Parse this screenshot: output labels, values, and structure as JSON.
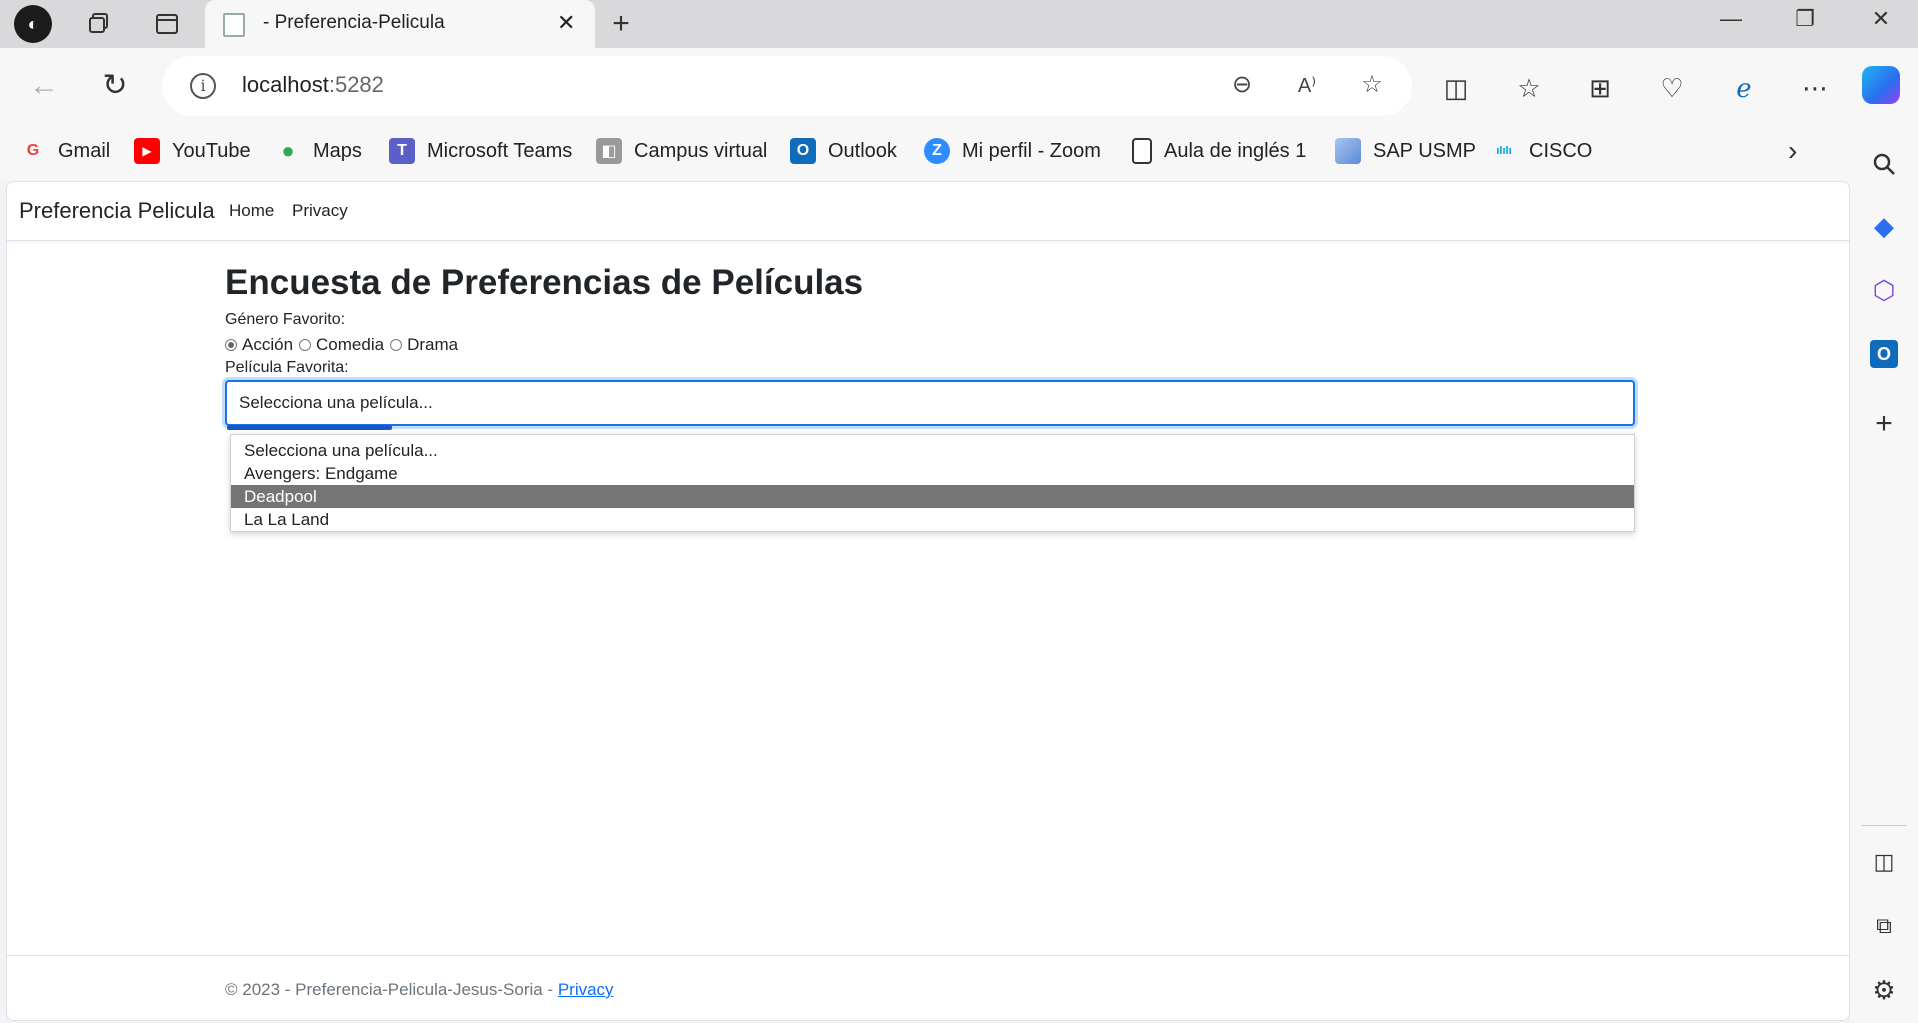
{
  "browser": {
    "tab_title": "- Preferencia-Pelicula",
    "url_host": "localhost",
    "url_port": ":5282"
  },
  "favorites": [
    {
      "label": "Gmail",
      "icon": "gmail-icon",
      "glyph": "G",
      "color": "#ea4335"
    },
    {
      "label": "YouTube",
      "icon": "youtube-icon",
      "glyph": "▶",
      "color": "#ff0000"
    },
    {
      "label": "Maps",
      "icon": "maps-icon",
      "glyph": "●",
      "color": "#34a853"
    },
    {
      "label": "Microsoft Teams",
      "icon": "teams-icon",
      "glyph": "T",
      "color": "#5b5fc7"
    },
    {
      "label": "Campus virtual",
      "icon": "campus-icon",
      "glyph": "◧",
      "color": "#8a8a8a"
    },
    {
      "label": "Outlook",
      "icon": "outlook-icon",
      "glyph": "O",
      "color": "#0f6cbd"
    },
    {
      "label": "Mi perfil - Zoom",
      "icon": "zoom-icon",
      "glyph": "Z",
      "color": "#2d8cff"
    },
    {
      "label": "Aula de inglés 1",
      "icon": "document-icon",
      "glyph": "▯",
      "color": "#ffffff"
    },
    {
      "label": "SAP USMP",
      "icon": "sap-icon",
      "glyph": "◆",
      "color": "#7aa7e8"
    },
    {
      "label": "CISCO",
      "icon": "cisco-icon",
      "glyph": "ılı",
      "color": "#049fd9"
    }
  ],
  "app": {
    "brand": "Preferencia Pelicula",
    "nav": [
      "Home",
      "Privacy"
    ]
  },
  "form": {
    "heading": "Encuesta de Preferencias de Películas",
    "genre_label": "Género Favorito:",
    "genres": [
      "Acción",
      "Comedia",
      "Drama"
    ],
    "selected_genre": "Acción",
    "movie_label": "Película Favorita:",
    "movie_selected": "Selecciona una película...",
    "movie_options": [
      "Selecciona una película...",
      "Avengers: Endgame",
      "Deadpool",
      "La La Land"
    ],
    "highlighted_option": "Deadpool"
  },
  "footer": {
    "text": "© 2023 - Preferencia-Pelicula-Jesus-Soria - ",
    "link": "Privacy"
  }
}
